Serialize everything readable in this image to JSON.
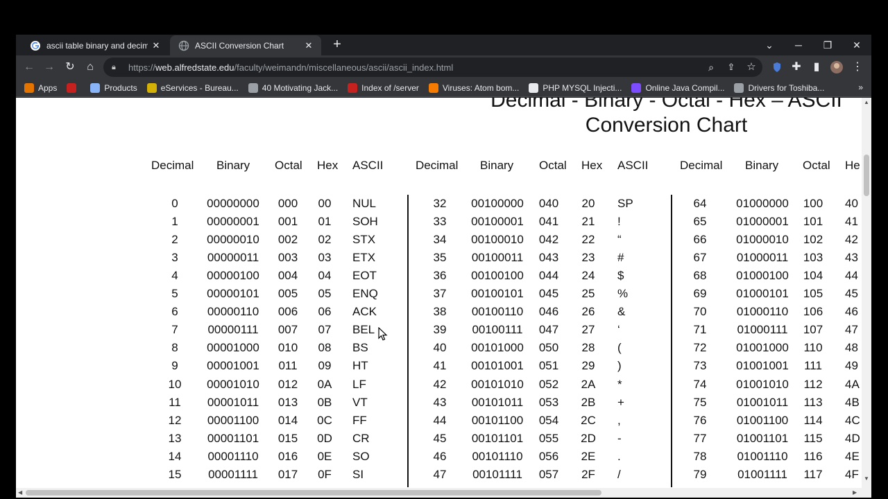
{
  "tabs": [
    {
      "title": "ascii table binary and decimal - G",
      "active": false
    },
    {
      "title": "ASCII Conversion Chart",
      "active": true
    }
  ],
  "address": {
    "scheme": "https://",
    "host": "web.alfredstate.edu",
    "path": "/faculty/weimandn/miscellaneous/ascii/ascii_index.html"
  },
  "bookmarks": [
    {
      "label": "Apps",
      "icon": "apps-grid-icon",
      "color": "#e37400"
    },
    {
      "label": "",
      "icon": "profile-bookmark-icon",
      "color": "#c5221f"
    },
    {
      "label": "Products",
      "icon": "products-icon",
      "color": "#8ab4f8"
    },
    {
      "label": "eServices - Bureau...",
      "icon": "eservices-icon",
      "color": "#d4b106"
    },
    {
      "label": "40 Motivating Jack...",
      "icon": "globe-icon",
      "color": "#9aa0a6"
    },
    {
      "label": "Index of /server",
      "icon": "filezilla-icon",
      "color": "#c5221f"
    },
    {
      "label": "Viruses: Atom bom...",
      "icon": "blogger-icon",
      "color": "#f57c00"
    },
    {
      "label": "PHP MYSQL Injecti...",
      "icon": "wordpress-icon",
      "color": "#e8eaed"
    },
    {
      "label": "Online Java Compil...",
      "icon": "bolt-icon",
      "color": "#7c4dff"
    },
    {
      "label": "Drivers for Toshiba...",
      "icon": "globe-icon",
      "color": "#9aa0a6"
    }
  ],
  "bookmarks_more": "»",
  "heading": {
    "line1": "Decimal - Binary - Octal - Hex – ASCII",
    "line2": "Conversion Chart"
  },
  "column_headers": [
    "Decimal",
    "Binary",
    "Octal",
    "Hex",
    "ASCII",
    "Decimal",
    "Binary",
    "Octal",
    "Hex",
    "ASCII",
    "Decimal",
    "Binary",
    "Octal",
    "He"
  ],
  "table": {
    "block1": [
      [
        "0",
        "00000000",
        "000",
        "00",
        "NUL"
      ],
      [
        "1",
        "00000001",
        "001",
        "01",
        "SOH"
      ],
      [
        "2",
        "00000010",
        "002",
        "02",
        "STX"
      ],
      [
        "3",
        "00000011",
        "003",
        "03",
        "ETX"
      ],
      [
        "4",
        "00000100",
        "004",
        "04",
        "EOT"
      ],
      [
        "5",
        "00000101",
        "005",
        "05",
        "ENQ"
      ],
      [
        "6",
        "00000110",
        "006",
        "06",
        "ACK"
      ],
      [
        "7",
        "00000111",
        "007",
        "07",
        "BEL"
      ],
      [
        "8",
        "00001000",
        "010",
        "08",
        "BS"
      ],
      [
        "9",
        "00001001",
        "011",
        "09",
        "HT"
      ],
      [
        "10",
        "00001010",
        "012",
        "0A",
        "LF"
      ],
      [
        "11",
        "00001011",
        "013",
        "0B",
        "VT"
      ],
      [
        "12",
        "00001100",
        "014",
        "0C",
        "FF"
      ],
      [
        "13",
        "00001101",
        "015",
        "0D",
        "CR"
      ],
      [
        "14",
        "00001110",
        "016",
        "0E",
        "SO"
      ],
      [
        "15",
        "00001111",
        "017",
        "0F",
        "SI"
      ]
    ],
    "block2": [
      [
        "32",
        "00100000",
        "040",
        "20",
        "SP"
      ],
      [
        "33",
        "00100001",
        "041",
        "21",
        "!"
      ],
      [
        "34",
        "00100010",
        "042",
        "22",
        "“"
      ],
      [
        "35",
        "00100011",
        "043",
        "23",
        "#"
      ],
      [
        "36",
        "00100100",
        "044",
        "24",
        "$"
      ],
      [
        "37",
        "00100101",
        "045",
        "25",
        "%"
      ],
      [
        "38",
        "00100110",
        "046",
        "26",
        "&"
      ],
      [
        "39",
        "00100111",
        "047",
        "27",
        "‘"
      ],
      [
        "40",
        "00101000",
        "050",
        "28",
        "("
      ],
      [
        "41",
        "00101001",
        "051",
        "29",
        ")"
      ],
      [
        "42",
        "00101010",
        "052",
        "2A",
        "*"
      ],
      [
        "43",
        "00101011",
        "053",
        "2B",
        "+"
      ],
      [
        "44",
        "00101100",
        "054",
        "2C",
        ","
      ],
      [
        "45",
        "00101101",
        "055",
        "2D",
        "-"
      ],
      [
        "46",
        "00101110",
        "056",
        "2E",
        "."
      ],
      [
        "47",
        "00101111",
        "057",
        "2F",
        "/"
      ]
    ],
    "block3": [
      [
        "64",
        "01000000",
        "100",
        "40"
      ],
      [
        "65",
        "01000001",
        "101",
        "41"
      ],
      [
        "66",
        "01000010",
        "102",
        "42"
      ],
      [
        "67",
        "01000011",
        "103",
        "43"
      ],
      [
        "68",
        "01000100",
        "104",
        "44"
      ],
      [
        "69",
        "01000101",
        "105",
        "45"
      ],
      [
        "70",
        "01000110",
        "106",
        "46"
      ],
      [
        "71",
        "01000111",
        "107",
        "47"
      ],
      [
        "72",
        "01001000",
        "110",
        "48"
      ],
      [
        "73",
        "01001001",
        "111",
        "49"
      ],
      [
        "74",
        "01001010",
        "112",
        "4A"
      ],
      [
        "75",
        "01001011",
        "113",
        "4B"
      ],
      [
        "76",
        "01001100",
        "114",
        "4C"
      ],
      [
        "77",
        "01001101",
        "115",
        "4D"
      ],
      [
        "78",
        "01001110",
        "116",
        "4E"
      ],
      [
        "79",
        "01001111",
        "117",
        "4F"
      ]
    ]
  },
  "colors": {
    "chrome_dark": "#202124",
    "chrome_toolbar": "#35363a",
    "page_bg": "#ffffff",
    "text": "#111111"
  }
}
